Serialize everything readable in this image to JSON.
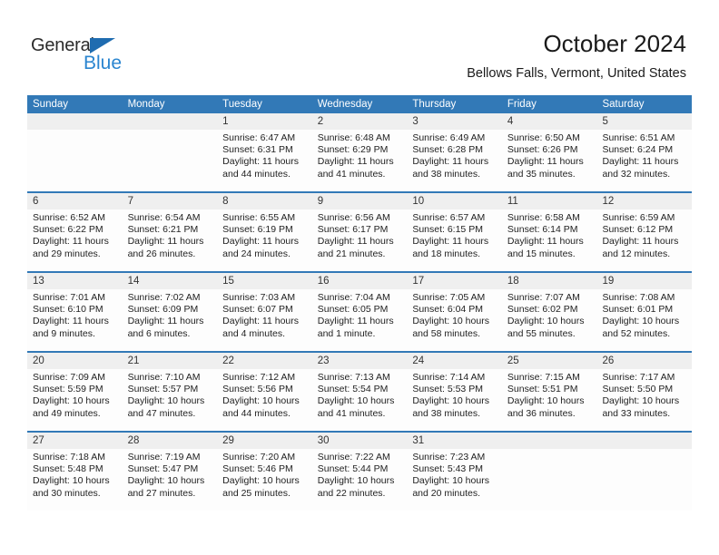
{
  "brand": {
    "name_part1": "General",
    "name_part2": "Blue",
    "triangle_icon": "blue-triangle-icon",
    "colors": {
      "dark": "#2b2b2b",
      "blue": "#2a85d0",
      "triangle": "#1f6cb0"
    }
  },
  "header": {
    "title": "October 2024",
    "subtitle": "Bellows Falls, Vermont, United States"
  },
  "colors": {
    "header_blue": "#3279b7",
    "row_divider_blue": "#3279b7",
    "daynum_band": "#efefef",
    "cell_bg": "#fdfdfd"
  },
  "weekdays": [
    "Sunday",
    "Monday",
    "Tuesday",
    "Wednesday",
    "Thursday",
    "Friday",
    "Saturday"
  ],
  "weeks": [
    [
      {
        "day": "",
        "sunrise": "",
        "sunset": "",
        "daylight1": "",
        "daylight2": "",
        "empty": true
      },
      {
        "day": "",
        "sunrise": "",
        "sunset": "",
        "daylight1": "",
        "daylight2": "",
        "empty": true
      },
      {
        "day": "1",
        "sunrise": "Sunrise: 6:47 AM",
        "sunset": "Sunset: 6:31 PM",
        "daylight1": "Daylight: 11 hours",
        "daylight2": "and 44 minutes."
      },
      {
        "day": "2",
        "sunrise": "Sunrise: 6:48 AM",
        "sunset": "Sunset: 6:29 PM",
        "daylight1": "Daylight: 11 hours",
        "daylight2": "and 41 minutes."
      },
      {
        "day": "3",
        "sunrise": "Sunrise: 6:49 AM",
        "sunset": "Sunset: 6:28 PM",
        "daylight1": "Daylight: 11 hours",
        "daylight2": "and 38 minutes."
      },
      {
        "day": "4",
        "sunrise": "Sunrise: 6:50 AM",
        "sunset": "Sunset: 6:26 PM",
        "daylight1": "Daylight: 11 hours",
        "daylight2": "and 35 minutes."
      },
      {
        "day": "5",
        "sunrise": "Sunrise: 6:51 AM",
        "sunset": "Sunset: 6:24 PM",
        "daylight1": "Daylight: 11 hours",
        "daylight2": "and 32 minutes."
      }
    ],
    [
      {
        "day": "6",
        "sunrise": "Sunrise: 6:52 AM",
        "sunset": "Sunset: 6:22 PM",
        "daylight1": "Daylight: 11 hours",
        "daylight2": "and 29 minutes."
      },
      {
        "day": "7",
        "sunrise": "Sunrise: 6:54 AM",
        "sunset": "Sunset: 6:21 PM",
        "daylight1": "Daylight: 11 hours",
        "daylight2": "and 26 minutes."
      },
      {
        "day": "8",
        "sunrise": "Sunrise: 6:55 AM",
        "sunset": "Sunset: 6:19 PM",
        "daylight1": "Daylight: 11 hours",
        "daylight2": "and 24 minutes."
      },
      {
        "day": "9",
        "sunrise": "Sunrise: 6:56 AM",
        "sunset": "Sunset: 6:17 PM",
        "daylight1": "Daylight: 11 hours",
        "daylight2": "and 21 minutes."
      },
      {
        "day": "10",
        "sunrise": "Sunrise: 6:57 AM",
        "sunset": "Sunset: 6:15 PM",
        "daylight1": "Daylight: 11 hours",
        "daylight2": "and 18 minutes."
      },
      {
        "day": "11",
        "sunrise": "Sunrise: 6:58 AM",
        "sunset": "Sunset: 6:14 PM",
        "daylight1": "Daylight: 11 hours",
        "daylight2": "and 15 minutes."
      },
      {
        "day": "12",
        "sunrise": "Sunrise: 6:59 AM",
        "sunset": "Sunset: 6:12 PM",
        "daylight1": "Daylight: 11 hours",
        "daylight2": "and 12 minutes."
      }
    ],
    [
      {
        "day": "13",
        "sunrise": "Sunrise: 7:01 AM",
        "sunset": "Sunset: 6:10 PM",
        "daylight1": "Daylight: 11 hours",
        "daylight2": "and 9 minutes."
      },
      {
        "day": "14",
        "sunrise": "Sunrise: 7:02 AM",
        "sunset": "Sunset: 6:09 PM",
        "daylight1": "Daylight: 11 hours",
        "daylight2": "and 6 minutes."
      },
      {
        "day": "15",
        "sunrise": "Sunrise: 7:03 AM",
        "sunset": "Sunset: 6:07 PM",
        "daylight1": "Daylight: 11 hours",
        "daylight2": "and 4 minutes."
      },
      {
        "day": "16",
        "sunrise": "Sunrise: 7:04 AM",
        "sunset": "Sunset: 6:05 PM",
        "daylight1": "Daylight: 11 hours",
        "daylight2": "and 1 minute."
      },
      {
        "day": "17",
        "sunrise": "Sunrise: 7:05 AM",
        "sunset": "Sunset: 6:04 PM",
        "daylight1": "Daylight: 10 hours",
        "daylight2": "and 58 minutes."
      },
      {
        "day": "18",
        "sunrise": "Sunrise: 7:07 AM",
        "sunset": "Sunset: 6:02 PM",
        "daylight1": "Daylight: 10 hours",
        "daylight2": "and 55 minutes."
      },
      {
        "day": "19",
        "sunrise": "Sunrise: 7:08 AM",
        "sunset": "Sunset: 6:01 PM",
        "daylight1": "Daylight: 10 hours",
        "daylight2": "and 52 minutes."
      }
    ],
    [
      {
        "day": "20",
        "sunrise": "Sunrise: 7:09 AM",
        "sunset": "Sunset: 5:59 PM",
        "daylight1": "Daylight: 10 hours",
        "daylight2": "and 49 minutes."
      },
      {
        "day": "21",
        "sunrise": "Sunrise: 7:10 AM",
        "sunset": "Sunset: 5:57 PM",
        "daylight1": "Daylight: 10 hours",
        "daylight2": "and 47 minutes."
      },
      {
        "day": "22",
        "sunrise": "Sunrise: 7:12 AM",
        "sunset": "Sunset: 5:56 PM",
        "daylight1": "Daylight: 10 hours",
        "daylight2": "and 44 minutes."
      },
      {
        "day": "23",
        "sunrise": "Sunrise: 7:13 AM",
        "sunset": "Sunset: 5:54 PM",
        "daylight1": "Daylight: 10 hours",
        "daylight2": "and 41 minutes."
      },
      {
        "day": "24",
        "sunrise": "Sunrise: 7:14 AM",
        "sunset": "Sunset: 5:53 PM",
        "daylight1": "Daylight: 10 hours",
        "daylight2": "and 38 minutes."
      },
      {
        "day": "25",
        "sunrise": "Sunrise: 7:15 AM",
        "sunset": "Sunset: 5:51 PM",
        "daylight1": "Daylight: 10 hours",
        "daylight2": "and 36 minutes."
      },
      {
        "day": "26",
        "sunrise": "Sunrise: 7:17 AM",
        "sunset": "Sunset: 5:50 PM",
        "daylight1": "Daylight: 10 hours",
        "daylight2": "and 33 minutes."
      }
    ],
    [
      {
        "day": "27",
        "sunrise": "Sunrise: 7:18 AM",
        "sunset": "Sunset: 5:48 PM",
        "daylight1": "Daylight: 10 hours",
        "daylight2": "and 30 minutes."
      },
      {
        "day": "28",
        "sunrise": "Sunrise: 7:19 AM",
        "sunset": "Sunset: 5:47 PM",
        "daylight1": "Daylight: 10 hours",
        "daylight2": "and 27 minutes."
      },
      {
        "day": "29",
        "sunrise": "Sunrise: 7:20 AM",
        "sunset": "Sunset: 5:46 PM",
        "daylight1": "Daylight: 10 hours",
        "daylight2": "and 25 minutes."
      },
      {
        "day": "30",
        "sunrise": "Sunrise: 7:22 AM",
        "sunset": "Sunset: 5:44 PM",
        "daylight1": "Daylight: 10 hours",
        "daylight2": "and 22 minutes."
      },
      {
        "day": "31",
        "sunrise": "Sunrise: 7:23 AM",
        "sunset": "Sunset: 5:43 PM",
        "daylight1": "Daylight: 10 hours",
        "daylight2": "and 20 minutes."
      },
      {
        "day": "",
        "sunrise": "",
        "sunset": "",
        "daylight1": "",
        "daylight2": "",
        "empty": true
      },
      {
        "day": "",
        "sunrise": "",
        "sunset": "",
        "daylight1": "",
        "daylight2": "",
        "empty": true
      }
    ]
  ]
}
